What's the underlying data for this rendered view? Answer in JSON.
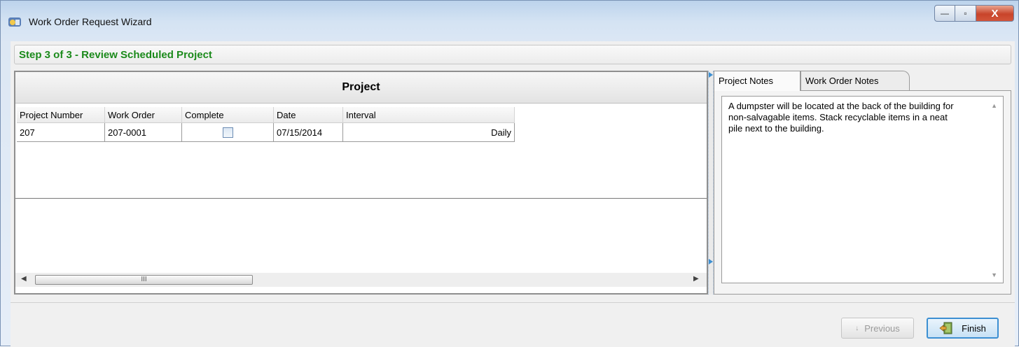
{
  "window": {
    "title": "Work Order Request Wizard",
    "controls": {
      "minimize": "—",
      "maximize": "▫",
      "close": "X"
    }
  },
  "step": {
    "title": "Step 3 of 3 - Review Scheduled Project"
  },
  "project_panel": {
    "caption": "Project",
    "columns": [
      "Project Number",
      "Work Order",
      "Complete",
      "Date",
      "Interval"
    ],
    "rows": [
      {
        "project_number": "207",
        "work_order": "207-0001",
        "complete": false,
        "date": "07/15/2014",
        "interval": "Daily"
      }
    ],
    "scroll_thumb_grip": "III"
  },
  "tabs": {
    "project_notes": "Project Notes",
    "work_order_notes": "Work Order Notes",
    "active": "project_notes"
  },
  "notes": {
    "text": "A dumpster will be located at the back of the building for non-salvagable items. Stack recyclable items in a neat pile next to the building."
  },
  "buttons": {
    "previous": "Previous",
    "finish": "Finish"
  },
  "colors": {
    "step_title": "#1b8a1b",
    "close_button": "#c8442a",
    "finish_border": "#3c8fd2"
  }
}
